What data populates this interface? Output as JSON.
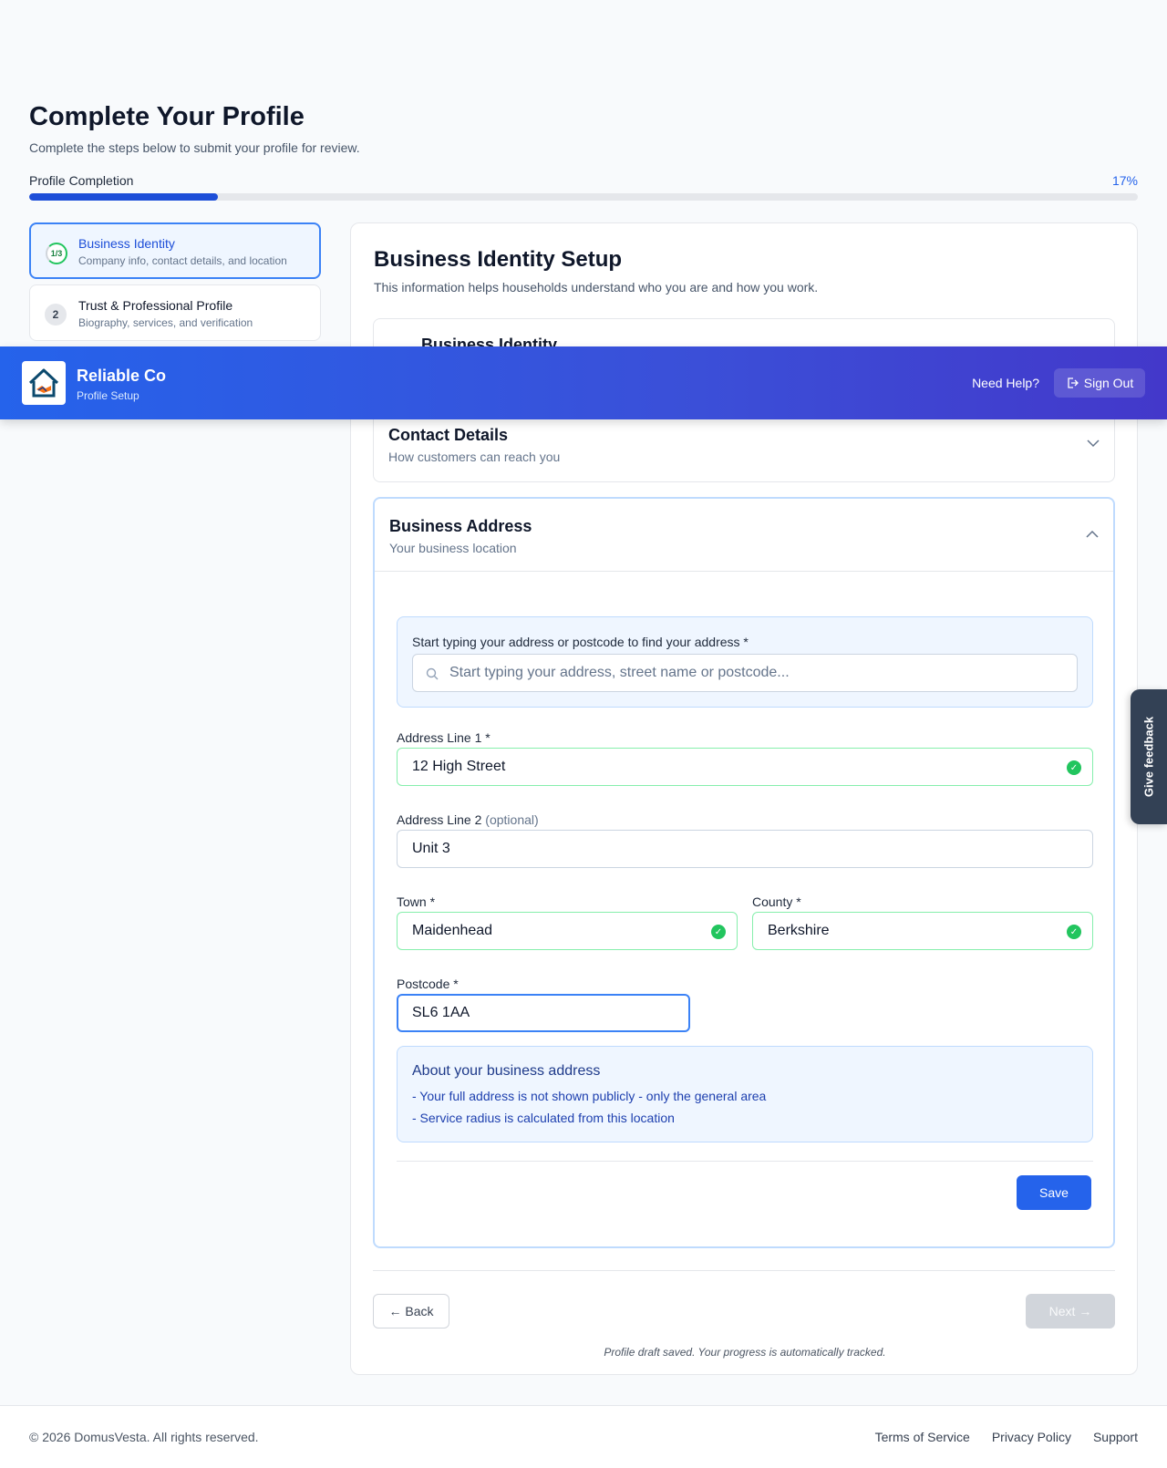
{
  "page": {
    "title": "Complete Your Profile",
    "subtitle": "Complete the steps below to submit your profile for review.",
    "progress_label": "Profile Completion",
    "progress_text": "17%",
    "progress_fraction": 0.17
  },
  "steps": [
    {
      "badge": "1/3",
      "title": "Business Identity",
      "desc": "Company info, contact details, and location",
      "active": true
    },
    {
      "badge": "2",
      "title": "Trust & Professional Profile",
      "desc": "Biography, services, and verification",
      "active": false
    }
  ],
  "card": {
    "title": "Business Identity Setup",
    "subtitle": "This information helps households understand who you are and how you work."
  },
  "sections": {
    "identity": {
      "title": "Business Identity"
    },
    "contact": {
      "title": "Contact Details",
      "subtitle": "How customers can reach you"
    },
    "address": {
      "title": "Business Address",
      "subtitle": "Your business location"
    }
  },
  "address_form": {
    "search_label": "Start typing your address or postcode to find your address *",
    "search_placeholder": "Start typing your address, street name or postcode...",
    "line1_label": "Address Line 1 *",
    "line1_value": "12 High Street",
    "line2_label": "Address Line 2",
    "line2_optional": "(optional)",
    "line2_value": "Unit 3",
    "town_label": "Town *",
    "town_value": "Maidenhead",
    "county_label": "County *",
    "county_value": "Berkshire",
    "postcode_label": "Postcode *",
    "postcode_value": "SL6 1AA"
  },
  "info": {
    "title": "About your business address",
    "line1": "- Your full address is not shown publicly - only the general area",
    "line2": "- Service radius is calculated from this location"
  },
  "buttons": {
    "save": "Save",
    "back": "← Back",
    "next": "Next →"
  },
  "draft_note": "Profile draft saved. Your progress is automatically tracked.",
  "header": {
    "brand": "Reliable Co",
    "brand_sub": "Profile Setup",
    "need_help": "Need Help?",
    "sign_out": "Sign Out"
  },
  "feedback": "Give feedback",
  "footer": {
    "copyright": "© 2026 DomusVesta. All rights reserved.",
    "links": [
      "Terms of Service",
      "Privacy Policy",
      "Support"
    ]
  },
  "colors": {
    "primary": "#2563eb",
    "success": "#22c55e",
    "header_gradient_end": "#4338ca"
  }
}
